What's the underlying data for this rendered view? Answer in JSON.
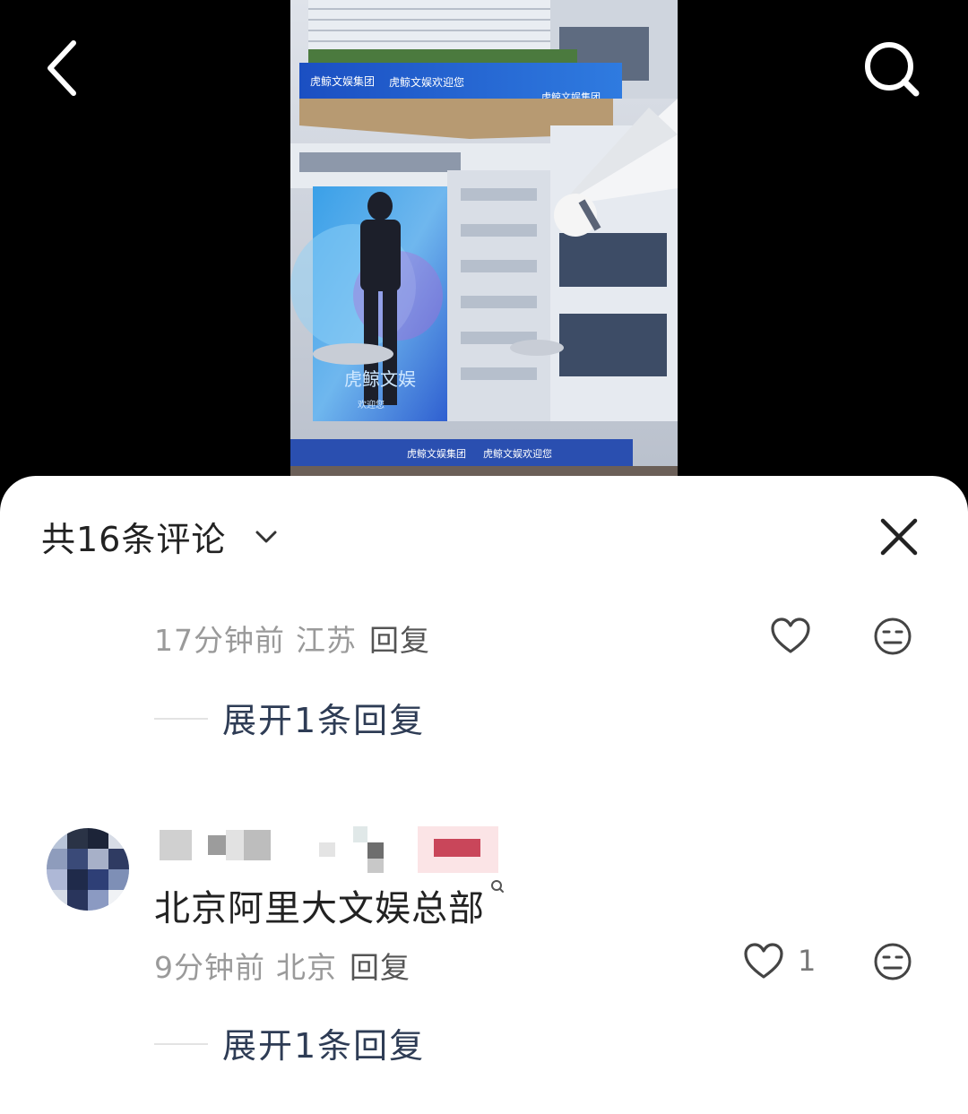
{
  "nav": {
    "back_icon": "chevron-left-icon",
    "search_icon": "search-icon"
  },
  "video": {
    "screen_text": "虎鲸文娱",
    "screen_subtext": "欢迎您",
    "banner_left": "虎鲸文娱集团",
    "banner_center": "虎鲸文娱欢迎您",
    "banner_right": "虎鲸文娱集团",
    "bottom_banner_left": "虎鲸文娱集团",
    "bottom_banner_right": "虎鲸文娱欢迎您"
  },
  "sheet": {
    "title": "共16条评论",
    "title_icon": "chevron-down-icon",
    "close_icon": "close-icon"
  },
  "comments": [
    {
      "time": "17分钟前",
      "location": "江苏",
      "reply": "回复",
      "likes": "",
      "expand": "展开1条回复"
    },
    {
      "username": "",
      "text": "北京阿里大文娱总部",
      "time": "9分钟前",
      "location": "北京",
      "reply": "回复",
      "likes": "1",
      "expand": "展开1条回复"
    }
  ],
  "colors": {
    "background_top": "#000000",
    "sheet": "#ffffff",
    "meta_text": "#9a9a9a",
    "expand_text": "#2e3c55"
  }
}
